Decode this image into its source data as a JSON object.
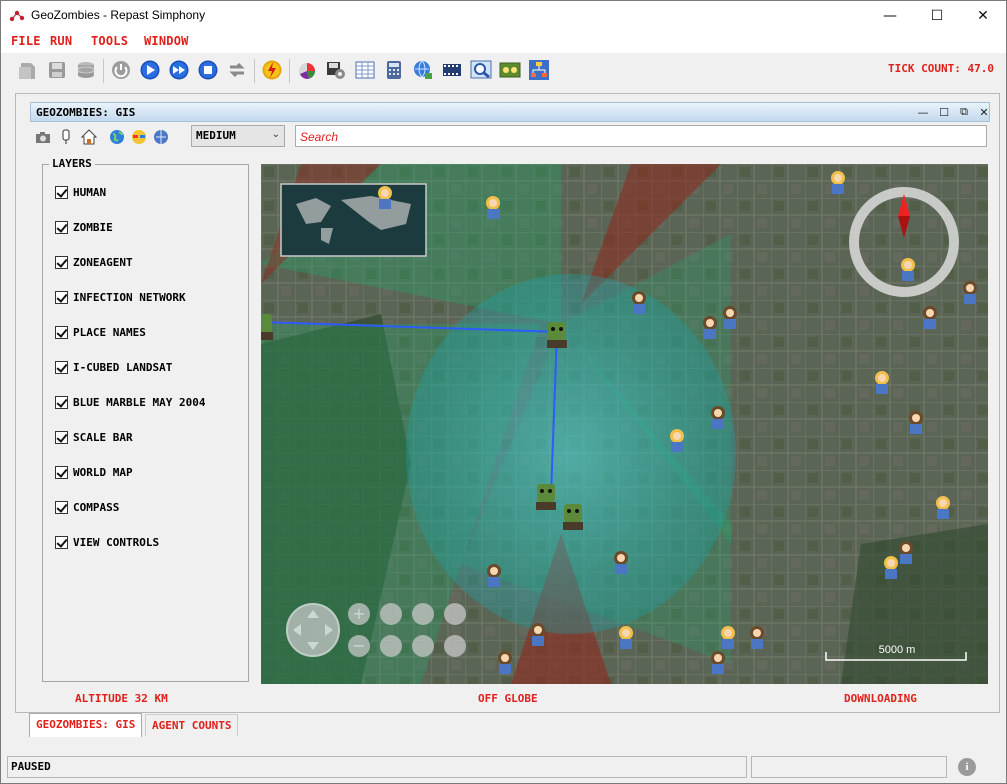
{
  "window": {
    "title": "GeoZombies - Repast Simphony",
    "minimize_glyph": "—",
    "maximize_glyph": "☐",
    "close_glyph": "✕"
  },
  "menu": {
    "items": [
      {
        "label": "FILE"
      },
      {
        "label": "RUN"
      },
      {
        "label": "TOOLS"
      },
      {
        "label": "WINDOW"
      }
    ]
  },
  "toolbar": {
    "tick_count": "TICK COUNT: 47.0",
    "icons": [
      "load-model-icon",
      "save-icon",
      "database-icon",
      "power-icon",
      "play-icon",
      "fast-forward-icon",
      "stop-icon",
      "reset-icon",
      "lightning-icon",
      "chart-icon",
      "save-settings-icon",
      "spreadsheet-icon",
      "calculator-icon",
      "network-icon",
      "film-icon",
      "magnifier-icon",
      "display-icon",
      "flowchart-icon"
    ]
  },
  "gis_panel": {
    "title": "GEOZOMBIES: GIS",
    "quality": "MEDIUM",
    "search_placeholder": "Search",
    "layers_title": "LAYERS",
    "layers": [
      {
        "label": "HUMAN",
        "checked": true
      },
      {
        "label": "ZOMBIE",
        "checked": true
      },
      {
        "label": "ZONEAGENT",
        "checked": true
      },
      {
        "label": "INFECTION NETWORK",
        "checked": true
      },
      {
        "label": "PLACE NAMES",
        "checked": true
      },
      {
        "label": "I-CUBED LANDSAT",
        "checked": true
      },
      {
        "label": "BLUE MARBLE MAY 2004",
        "checked": true
      },
      {
        "label": "SCALE BAR",
        "checked": true
      },
      {
        "label": "WORLD MAP",
        "checked": true
      },
      {
        "label": "COMPASS",
        "checked": true
      },
      {
        "label": "VIEW CONTROLS",
        "checked": true
      }
    ],
    "altitude": "ALTITUDE   32 KM",
    "globe_status": "OFF GLOBE",
    "download_status": "DOWNLOADING",
    "scale_label": "5000 m",
    "colors": {
      "zone_green": "#1fa86a",
      "zone_red": "#8b2d22",
      "network": "#2d5bff",
      "accent_red": "#e0201a"
    }
  },
  "tabs": [
    {
      "label": "GEOZOMBIES: GIS",
      "active": true
    },
    {
      "label": "AGENT COUNTS",
      "active": false
    }
  ],
  "status": {
    "state": "PAUSED",
    "info_glyph": "i"
  }
}
